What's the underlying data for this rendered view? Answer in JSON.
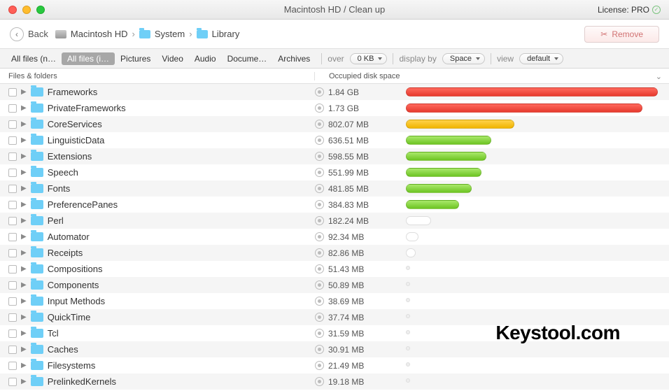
{
  "window": {
    "title": "Macintosh HD / Clean up"
  },
  "license": {
    "label": "License: PRO"
  },
  "toolbar": {
    "back": "Back",
    "crumbs": [
      "Macintosh HD",
      "System",
      "Library"
    ],
    "remove": "Remove"
  },
  "filters": {
    "tabs": [
      "All files (n…",
      "All files (i…",
      "Pictures",
      "Video",
      "Audio",
      "Docume…",
      "Archives"
    ],
    "active": 1,
    "over_label": "over",
    "over_value": "0 KB",
    "display_by_label": "display by",
    "display_by_value": "Space",
    "view_label": "view",
    "view_value": "default"
  },
  "columns": {
    "name": "Files & folders",
    "space": "Occupied disk space"
  },
  "rows": [
    {
      "name": "Frameworks",
      "size": "1.84 GB",
      "pct": 100,
      "color": "red"
    },
    {
      "name": "PrivateFrameworks",
      "size": "1.73 GB",
      "pct": 94,
      "color": "red"
    },
    {
      "name": "CoreServices",
      "size": "802.07 MB",
      "pct": 43,
      "color": "orange"
    },
    {
      "name": "LinguisticData",
      "size": "636.51 MB",
      "pct": 34,
      "color": "green"
    },
    {
      "name": "Extensions",
      "size": "598.55 MB",
      "pct": 32,
      "color": "green"
    },
    {
      "name": "Speech",
      "size": "551.99 MB",
      "pct": 30,
      "color": "green"
    },
    {
      "name": "Fonts",
      "size": "481.85 MB",
      "pct": 26,
      "color": "green"
    },
    {
      "name": "PreferencePanes",
      "size": "384.83 MB",
      "pct": 21,
      "color": "green"
    },
    {
      "name": "Perl",
      "size": "182.24 MB",
      "pct": 10,
      "color": "empty"
    },
    {
      "name": "Automator",
      "size": "92.34 MB",
      "pct": 5,
      "color": "empty"
    },
    {
      "name": "Receipts",
      "size": "82.86 MB",
      "pct": 4,
      "color": "empty"
    },
    {
      "name": "Compositions",
      "size": "51.43 MB",
      "pct": 0,
      "color": "tiny"
    },
    {
      "name": "Components",
      "size": "50.89 MB",
      "pct": 0,
      "color": "tiny"
    },
    {
      "name": "Input Methods",
      "size": "38.69 MB",
      "pct": 0,
      "color": "tiny"
    },
    {
      "name": "QuickTime",
      "size": "37.74 MB",
      "pct": 0,
      "color": "tiny"
    },
    {
      "name": "Tcl",
      "size": "31.59 MB",
      "pct": 0,
      "color": "tiny"
    },
    {
      "name": "Caches",
      "size": "30.91 MB",
      "pct": 0,
      "color": "tiny"
    },
    {
      "name": "Filesystems",
      "size": "21.49 MB",
      "pct": 0,
      "color": "tiny"
    },
    {
      "name": "PrelinkedKernels",
      "size": "19.18 MB",
      "pct": 0,
      "color": "tiny"
    }
  ],
  "watermark": "Keystool.com"
}
